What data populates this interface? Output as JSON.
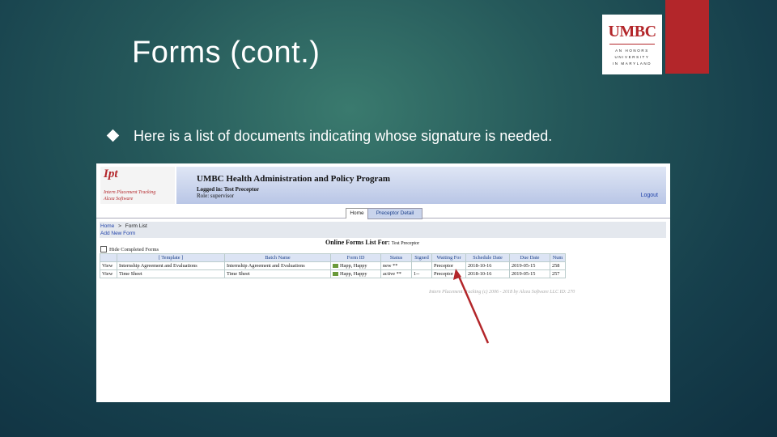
{
  "slide": {
    "title": "Forms (cont.)",
    "bullet": "Here is a list of documents indicating whose signature is needed."
  },
  "logo": {
    "main": "UMBC",
    "line1": "AN HONORS",
    "line2": "UNIVERSITY",
    "line3": "IN MARYLAND"
  },
  "app": {
    "logo": {
      "name": "Ipt",
      "tag1": "Intern Placement Tracking",
      "tag2": "Alcea Software"
    },
    "banner": {
      "title": "UMBC Health Administration and Policy Program",
      "logged_in": "Logged in: Test Preceptor",
      "role": "Role: supervisor",
      "logout": "Logout"
    },
    "tabs": {
      "home": "Home",
      "detail": "Preceptor Detail"
    },
    "breadcrumb": {
      "home": "Home",
      "sep": ">",
      "current": "Form List"
    },
    "add_new": "Add New Form",
    "list_title": "Online Forms List For:",
    "list_for": "Test Preceptor",
    "hide_completed": "Hide Completed Forms",
    "table": {
      "headers": [
        "[ Template ]",
        "Batch Name",
        "Form ID",
        "Status",
        "Signed",
        "Waiting For",
        "Schedule Date",
        "Due Date",
        "Num"
      ],
      "rows": [
        {
          "view": "View",
          "template": "Internship Agreement and Evaluations",
          "batch": "Internship Agreement and Evaluations",
          "form_id": "Happ, Happy",
          "status": "new **",
          "signed": "",
          "waiting": "Preceptor",
          "schedule": "2018-10-16",
          "due": "2019-05-15",
          "num": "258"
        },
        {
          "view": "View",
          "template": "Time Sheet",
          "batch": "Time Sheet",
          "form_id": "Happ, Happy",
          "status": "active **",
          "signed": "1--",
          "waiting": "Preceptor",
          "schedule": "2018-10-16",
          "due": "2019-05-15",
          "num": "257"
        }
      ]
    },
    "footer": "Intern Placement Tracking (c) 2006 - 2018    by Alcea Software LLC    ID: 270"
  },
  "colors": {
    "umbc_red": "#b3262a",
    "annotation_arrow": "#b3262a"
  }
}
